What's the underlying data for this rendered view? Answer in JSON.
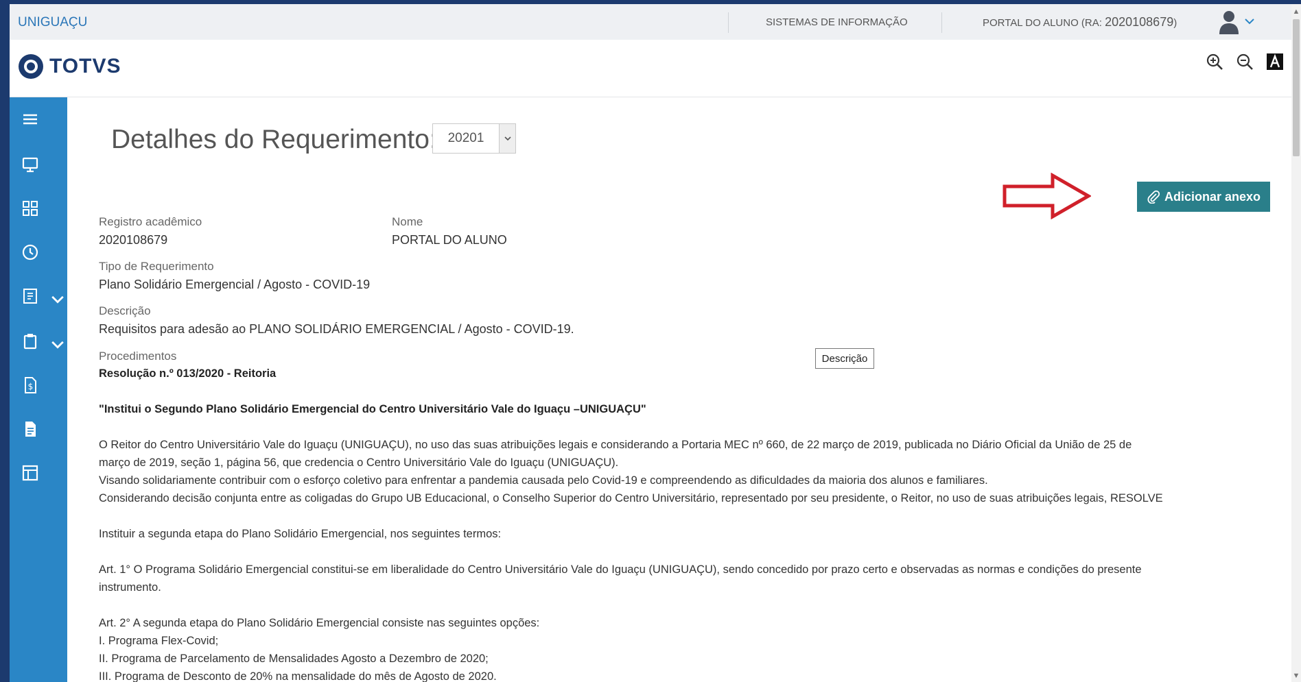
{
  "topbar": {
    "brand": "UNIGUAÇU",
    "sistemas": "SISTEMAS DE INFORMAÇÃO",
    "portal_prefix": "PORTAL DO ALUNO (RA: ",
    "ra": "2020108679",
    "portal_suffix": ")"
  },
  "header": {
    "logo_text": "TOTVS"
  },
  "icons": {
    "zoom_in": "zoom-in-icon",
    "zoom_out": "zoom-out-icon",
    "font": "font-size-icon",
    "sidebar": [
      "menu-icon",
      "monitor-icon",
      "grid-icon",
      "clock-icon",
      "document-list-icon",
      "clipboard-icon",
      "finance-icon",
      "file-icon",
      "layout-icon"
    ]
  },
  "colors": {
    "sidebar": "#2a86c6",
    "button": "#2a7f8a",
    "arrow": "#d0202a",
    "frame": "#1c3a6e"
  },
  "page": {
    "title": "Detalhes do Requerimento:",
    "period": "20201",
    "attach_label": "Adicionar anexo",
    "desc_button": "Descrição"
  },
  "fields": {
    "ra_label": "Registro acadêmico",
    "ra_value": "2020108679",
    "nome_label": "Nome",
    "nome_value": "PORTAL DO ALUNO",
    "tipo_label": "Tipo de Requerimento",
    "tipo_value": "Plano Solidário Emergencial / Agosto - COVID-19",
    "descricao_label": "Descrição",
    "descricao_value": "Requisitos para adesão ao PLANO SOLIDÁRIO EMERGENCIAL / Agosto - COVID-19.",
    "proc_label": "Procedimentos"
  },
  "content": {
    "resolucao": "Resolução n.º 013/2020 - Reitoria",
    "institui": "\"Institui o Segundo Plano Solidário Emergencial do Centro Universitário Vale do Iguaçu –UNIGUAÇU\"",
    "p1a": "O Reitor do Centro Universitário Vale do Iguaçu (UNIGUAÇU), no uso das suas atribuições legais e considerando a Portaria MEC nº 660, de 22 março de 2019, publicada no Diário Oficial da União de 25 de",
    "p1b": "março de 2019, seção 1, página 56, que credencia o Centro Universitário Vale do Iguaçu (UNIGUAÇU).",
    "p2": "Visando solidariamente contribuir com o esforço coletivo para enfrentar a pandemia causada pelo Covid-19 e compreendendo as dificuldades da maioria dos alunos e familiares.",
    "p3": "Considerando decisão conjunta entre as coligadas do Grupo UB Educacional, o Conselho Superior do Centro Universitário, representado por seu presidente, o Reitor, no uso de suas atribuições legais, RESOLVE",
    "p4": "Instituir a segunda etapa do Plano Solidário Emergencial, nos seguintes termos:",
    "art1a": "Art. 1° O Programa Solidário Emergencial constitui-se em liberalidade do Centro Universitário Vale do Iguaçu (UNIGUAÇU), sendo concedido por prazo certo e observadas as normas e condições do presente",
    "art1b": "instrumento.",
    "art2": "Art. 2° A segunda etapa do Plano Solidário Emergencial consiste nas seguintes opções:",
    "item1": "I. Programa Flex-Covid;",
    "item2": "II. Programa de Parcelamento de Mensalidades Agosto a Dezembro de 2020;",
    "item3": "III. Programa de Desconto de 20% na mensalidade do mês de Agosto de 2020."
  }
}
